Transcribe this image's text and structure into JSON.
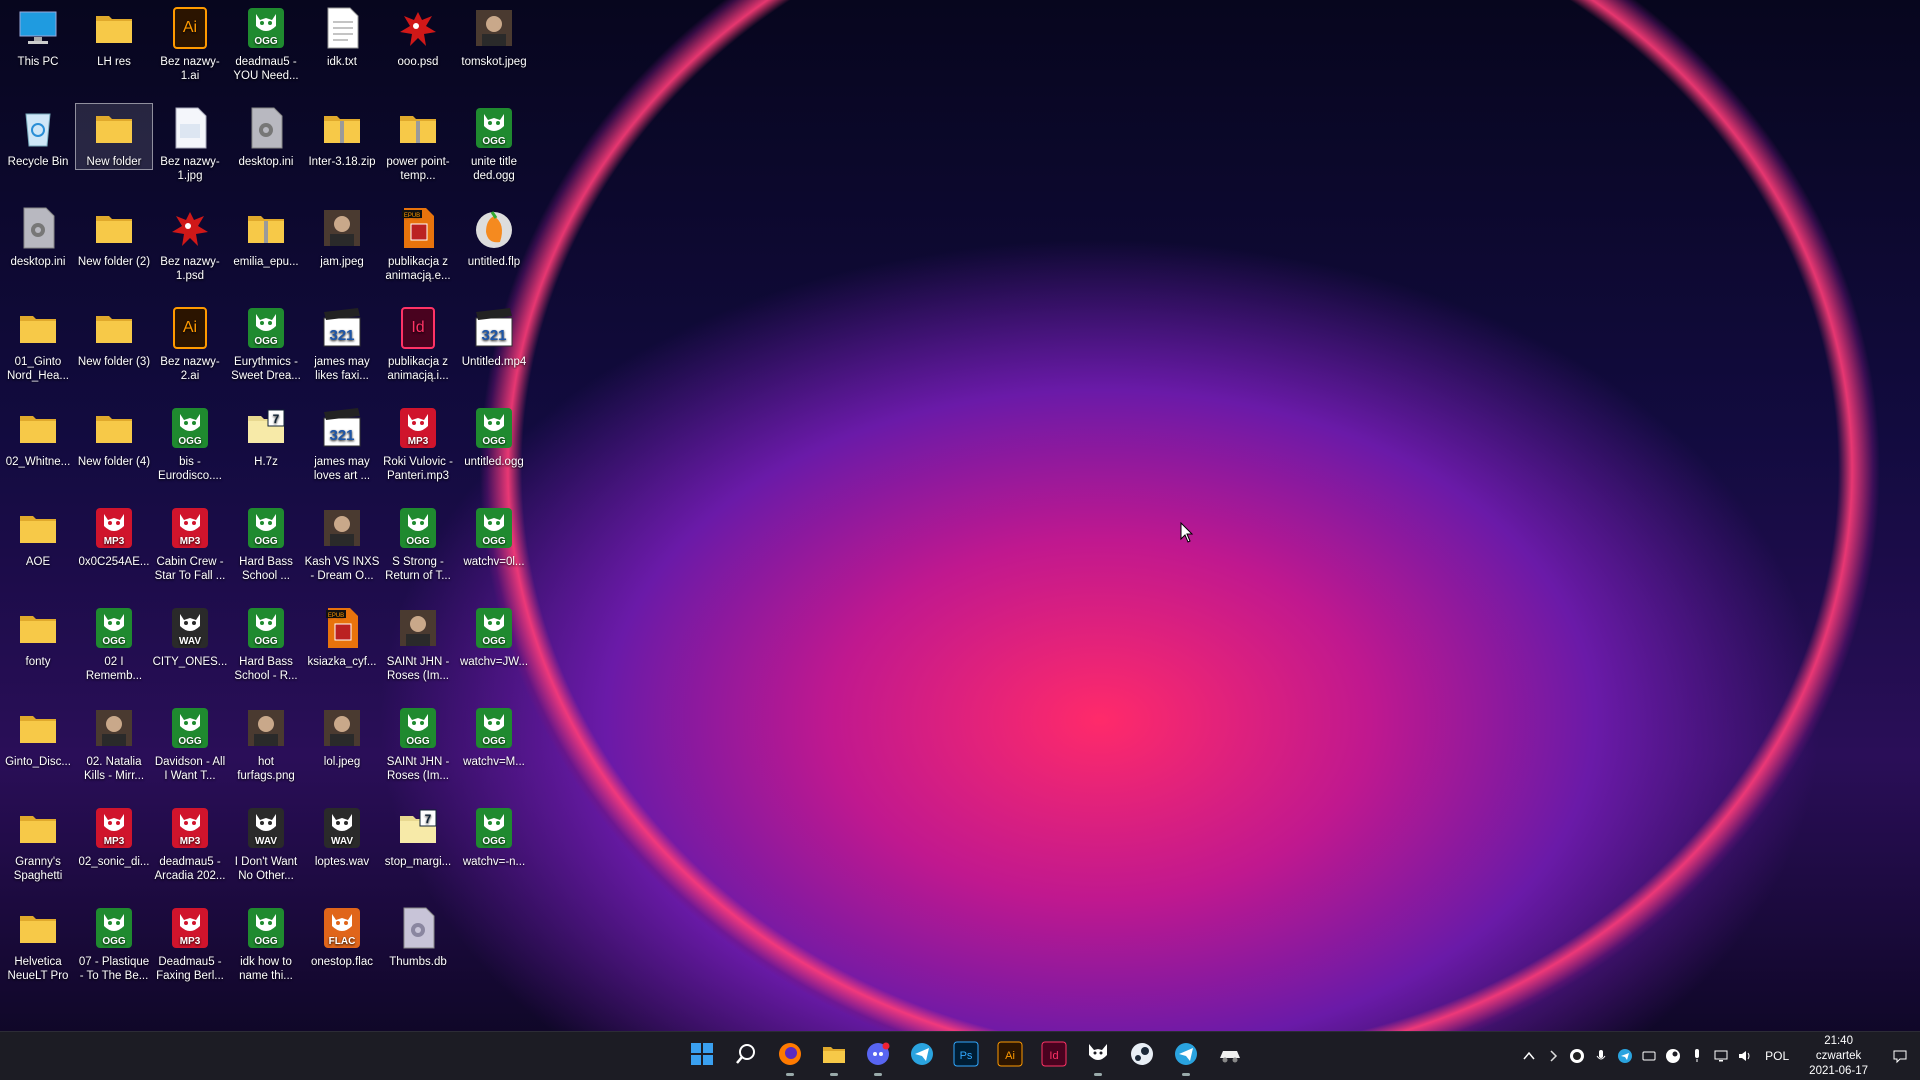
{
  "desktop": {
    "icons": [
      {
        "label": "This PC",
        "type": "pc"
      },
      {
        "label": "LH res",
        "type": "folder"
      },
      {
        "label": "Bez nazwy-1.ai",
        "type": "ai"
      },
      {
        "label": "deadmau5 - YOU Need...",
        "type": "ogg"
      },
      {
        "label": "idk.txt",
        "type": "txt"
      },
      {
        "label": "ooo.psd",
        "type": "splat"
      },
      {
        "label": "tomskot.jpeg",
        "type": "photo"
      },
      {
        "label": "Recycle Bin",
        "type": "recycle"
      },
      {
        "label": "New folder",
        "type": "folder",
        "selected": true
      },
      {
        "label": "Bez nazwy-1.jpg",
        "type": "jpg"
      },
      {
        "label": "desktop.ini",
        "type": "ini"
      },
      {
        "label": "Inter-3.18.zip",
        "type": "zip"
      },
      {
        "label": "power point-temp...",
        "type": "zip"
      },
      {
        "label": "unite title ded.ogg",
        "type": "ogg"
      },
      {
        "label": "desktop.ini",
        "type": "ini"
      },
      {
        "label": "New folder (2)",
        "type": "folder"
      },
      {
        "label": "Bez nazwy-1.psd",
        "type": "splat"
      },
      {
        "label": "emilia_epu...",
        "type": "zip"
      },
      {
        "label": "jam.jpeg",
        "type": "photo"
      },
      {
        "label": "publikacja z animacją.e...",
        "type": "epub"
      },
      {
        "label": "untitled.flp",
        "type": "flp"
      },
      {
        "label": "01_Ginto Nord_Hea...",
        "type": "folder"
      },
      {
        "label": "New folder (3)",
        "type": "folder"
      },
      {
        "label": "Bez nazwy-2.ai",
        "type": "ai"
      },
      {
        "label": "Eurythmics - Sweet Drea...",
        "type": "ogg"
      },
      {
        "label": "james may likes faxi...",
        "type": "mp4"
      },
      {
        "label": "publikacja z animacją.i...",
        "type": "indd"
      },
      {
        "label": "Untitled.mp4",
        "type": "mp4"
      },
      {
        "label": "02_Whitne...",
        "type": "folder"
      },
      {
        "label": "New folder (4)",
        "type": "folder"
      },
      {
        "label": "bis - Eurodisco....",
        "type": "ogg"
      },
      {
        "label": "H.7z",
        "type": "sevenz"
      },
      {
        "label": "james may loves art ...",
        "type": "mp4"
      },
      {
        "label": "Roki Vulovic - Panteri.mp3",
        "type": "mp3"
      },
      {
        "label": "untitled.ogg",
        "type": "ogg"
      },
      {
        "label": "AOE",
        "type": "folder"
      },
      {
        "label": "0x0C254AE...",
        "type": "mp3"
      },
      {
        "label": "Cabin Crew - Star To Fall ...",
        "type": "mp3"
      },
      {
        "label": "Hard Bass School ...",
        "type": "ogg"
      },
      {
        "label": "Kash VS INXS - Dream O...",
        "type": "photo"
      },
      {
        "label": "S Strong - Return of T...",
        "type": "ogg"
      },
      {
        "label": "watchv=0l...",
        "type": "ogg"
      },
      {
        "label": "fonty",
        "type": "folder"
      },
      {
        "label": "02 I Rememb...",
        "type": "ogg"
      },
      {
        "label": "CITY_ONES...",
        "type": "wav"
      },
      {
        "label": "Hard Bass School - R...",
        "type": "ogg"
      },
      {
        "label": "ksiazka_cyf...",
        "type": "epub"
      },
      {
        "label": "SAINt JHN - Roses (Im...",
        "type": "photo"
      },
      {
        "label": "watchv=JW...",
        "type": "ogg"
      },
      {
        "label": "Ginto_Disc...",
        "type": "folder"
      },
      {
        "label": "02. Natalia Kills - Mirr...",
        "type": "photo"
      },
      {
        "label": "Davidson - All I Want T...",
        "type": "ogg"
      },
      {
        "label": "hot furfags.png",
        "type": "photo"
      },
      {
        "label": "lol.jpeg",
        "type": "photo"
      },
      {
        "label": "SAINt JHN - Roses (Im...",
        "type": "ogg"
      },
      {
        "label": "watchv=M...",
        "type": "ogg"
      },
      {
        "label": "Granny's Spaghetti",
        "type": "folder"
      },
      {
        "label": "02_sonic_di...",
        "type": "mp3"
      },
      {
        "label": "deadmau5 - Arcadia 202...",
        "type": "mp3"
      },
      {
        "label": "I Don't Want No Other...",
        "type": "wav"
      },
      {
        "label": "loptes.wav",
        "type": "wav"
      },
      {
        "label": "stop_margi...",
        "type": "sevenz"
      },
      {
        "label": "watchv=-n...",
        "type": "ogg"
      },
      {
        "label": "Helvetica NeueLT Pro",
        "type": "folder"
      },
      {
        "label": "07 - Plastique - To The Be...",
        "type": "ogg"
      },
      {
        "label": "Deadmau5 - Faxing Berl...",
        "type": "mp3"
      },
      {
        "label": "idk how to name thi...",
        "type": "ogg"
      },
      {
        "label": "onestop.flac",
        "type": "flac"
      },
      {
        "label": "Thumbs.db",
        "type": "db"
      }
    ]
  },
  "file_badges": {
    "ogg": "OGG",
    "mp3": "MP3",
    "wav": "WAV",
    "flac": "FLAC",
    "epub": "EPUB",
    "ai": "Ai",
    "indd": "Id",
    "mp4": "321"
  },
  "taskbar": {
    "apps": [
      {
        "name": "start-button",
        "icon": "windows-logo-icon"
      },
      {
        "name": "search-button",
        "icon": "search-icon"
      },
      {
        "name": "firefox-button",
        "icon": "firefox-icon",
        "running": true
      },
      {
        "name": "file-explorer-button",
        "icon": "folder-icon",
        "running": true
      },
      {
        "name": "discord-button",
        "icon": "discord-icon",
        "running": true
      },
      {
        "name": "telegram-button",
        "icon": "telegram-icon"
      },
      {
        "name": "photoshop-button",
        "icon": "photoshop-icon",
        "label": "Ps"
      },
      {
        "name": "illustrator-button",
        "icon": "illustrator-icon",
        "label": "Ai"
      },
      {
        "name": "indesign-button",
        "icon": "indesign-icon",
        "label": "Id"
      },
      {
        "name": "foobar-button",
        "icon": "fox-mask-icon",
        "running": true
      },
      {
        "name": "steam-button",
        "icon": "steam-icon"
      },
      {
        "name": "telegram2-button",
        "icon": "telegram-icon",
        "running": true
      },
      {
        "name": "game-button",
        "icon": "car-icon"
      }
    ],
    "tray": {
      "language": "POL",
      "time": "21:40",
      "day": "czwartek",
      "date": "2021-06-17"
    }
  },
  "colors": {
    "ogg_bg": "#1f8a2f",
    "mp3_bg": "#d0142c",
    "folder": "#f7c948",
    "taskbar": "#1c1c24"
  }
}
